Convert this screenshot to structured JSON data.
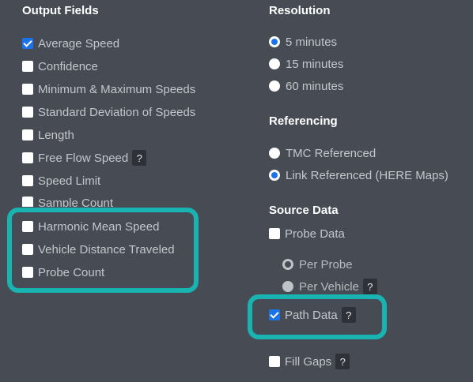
{
  "output_fields": {
    "heading": "Output Fields",
    "items": [
      {
        "label": "Average Speed",
        "checked": true
      },
      {
        "label": "Confidence",
        "checked": false
      },
      {
        "label": "Minimum & Maximum Speeds",
        "checked": false
      },
      {
        "label": "Standard Deviation of Speeds",
        "checked": false
      },
      {
        "label": "Length",
        "checked": false
      },
      {
        "label": "Free Flow Speed",
        "checked": false,
        "help": "?"
      },
      {
        "label": "Speed Limit",
        "checked": false
      },
      {
        "label": "Sample Count",
        "checked": false
      },
      {
        "label": "Harmonic Mean Speed",
        "checked": false
      },
      {
        "label": "Vehicle Distance Traveled",
        "checked": false
      },
      {
        "label": "Probe Count",
        "checked": false
      }
    ]
  },
  "resolution": {
    "heading": "Resolution",
    "options": [
      {
        "label": "5 minutes",
        "selected": true
      },
      {
        "label": "15 minutes",
        "selected": false
      },
      {
        "label": "60 minutes",
        "selected": false
      }
    ]
  },
  "referencing": {
    "heading": "Referencing",
    "options": [
      {
        "label": "TMC Referenced",
        "selected": false
      },
      {
        "label": "Link Referenced (HERE Maps)",
        "selected": true
      }
    ]
  },
  "source_data": {
    "heading": "Source Data",
    "probe_data": {
      "label": "Probe Data",
      "checked": false
    },
    "per_probe": {
      "label": "Per Probe",
      "selected": true
    },
    "per_vehicle": {
      "label": "Per Vehicle",
      "selected": false,
      "help": "?"
    },
    "path_data": {
      "label": "Path Data",
      "checked": true,
      "help": "?"
    },
    "fill_gaps": {
      "label": "Fill Gaps",
      "checked": false,
      "help": "?"
    }
  },
  "colors": {
    "background": "#474c54",
    "highlight": "#19b3b1",
    "accent": "#1a73e8"
  }
}
